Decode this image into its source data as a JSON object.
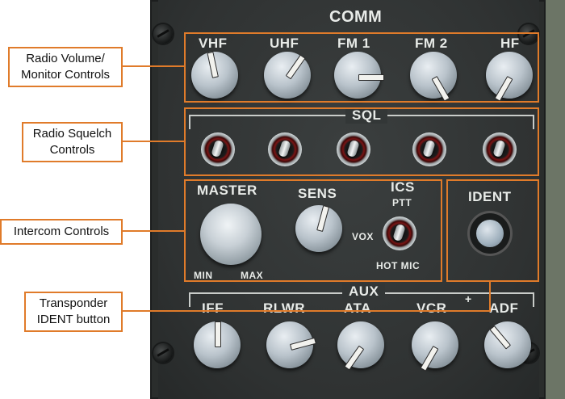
{
  "panel": {
    "title": "COMM",
    "volume_labels": [
      "VHF",
      "UHF",
      "FM 1",
      "FM 2",
      "HF"
    ],
    "squelch_label": "SQL",
    "master_label": "MASTER",
    "master_min": "MIN",
    "master_max": "MAX",
    "sens_label": "SENS",
    "ics_label": "ICS",
    "ptt_label": "PTT",
    "vox_label": "VOX",
    "hotmic_label": "HOT MIC",
    "ident_label": "IDENT",
    "aux_label": "AUX",
    "aux_labels": [
      "IFF",
      "RLWR",
      "ATA",
      "VCR",
      "ADF"
    ]
  },
  "callouts": {
    "volume": "Radio Volume/\nMonitor Controls",
    "squelch": "Radio Squelch\nControls",
    "intercom": "Intercom Controls",
    "ident": "Transponder\nIDENT button"
  },
  "colors": {
    "callout_orange": "#e07b2a",
    "panel_dark": "#2f3232",
    "label_white": "#e8ebe8"
  }
}
